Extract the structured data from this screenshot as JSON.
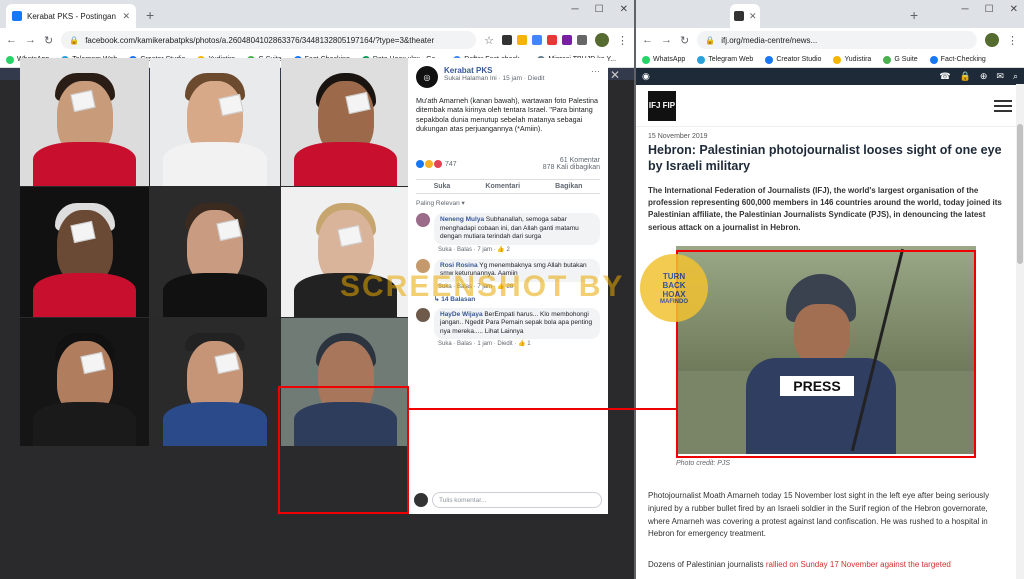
{
  "left_browser": {
    "tab_title": "Kerabat PKS - Postingan",
    "url": "facebook.com/kamikerabatpks/photos/a.2604804102863376/3448132805197164/?type=3&theater",
    "bookmarks": [
      "WhatsApp",
      "Telegram Web",
      "Creator Studio",
      "Yudistira",
      "G Suite",
      "Fact-Checking",
      "Data Hoax.xlsx - Go...",
      "Daftar Fact-check...",
      "Migrasi TBHJD ke Y..."
    ]
  },
  "post": {
    "page_name": "Kerabat PKS",
    "meta": "Sukai Halaman Ini · 15 jam · Diedit",
    "text": "Mu'ath Amarneh (kanan bawah), wartawan foto Palestina ditembak mata kirinya oleh tentara Israel. \"Para bintang sepakbola dunia menutup sebelah matanya sebagai dukungan atas perjuangannya (*Amiin).",
    "reactions_count": "747",
    "comments_count": "61 Komentar",
    "shares_count": "878 Kali dibagikan",
    "actions": [
      "Suka",
      "Komentari",
      "Bagikan"
    ],
    "sort_label": "Paling Relevan ▾",
    "comments": [
      {
        "name": "Neneng Mulya",
        "text": "Subhanallah, semoga sabar menghadapi cobaan ini, dan Allah ganti matamu dengan mutiara terindah dari surga",
        "meta": "Suka · Balas · 7 jam",
        "likes": "2"
      },
      {
        "name": "Rosi Rosina",
        "text": "Yg menembaknya smg Allah butakan smw keturunannya. Aamiin",
        "meta": "Suka · Balas · 7 jam",
        "likes": "28"
      },
      {
        "name": "HayDe Wijaya",
        "text": "BerEmpati harus... Klo membohongi jangan.. Ngedit Para Pemain sepak bola apa penting nya mereka..... Lihat Lainnya",
        "meta": "Suka · Balas · 1 jam · Diedit",
        "likes": "1"
      }
    ],
    "replies": "14 Balasan",
    "write_placeholder": "Tulis komentar..."
  },
  "watermark": "SCREENSHOT BY",
  "stamp_text": "TURN BACK HOAX · MASYARAKAT ANTI FITNAH INDONESIA · MAFINDO",
  "right_browser": {
    "url": "ifj.org/media-centre/news...",
    "bookmarks": [
      "WhatsApp",
      "Telegram Web",
      "Creator Studio",
      "Yudistira",
      "G Suite",
      "Fact-Checking"
    ]
  },
  "article": {
    "logo": "IFJ FIP",
    "date": "15 November 2019",
    "title": "Hebron: Palestinian photojournalist looses sight of one eye by Israeli military",
    "lead": "The International Federation of Journalists (IFJ), the world's largest organisation of the profession representing 600,000 members in 146 countries around the world, today joined its Palestinian affiliate, the Palestinian Journalists Syndicate (PJS), in denouncing the latest serious attack on a journalist in Hebron.",
    "photo_vest_text": "PRESS",
    "photo_credit": "Photo credit: PJS",
    "body": "Photojournalist Moath Amarneh today 15 November lost sight in the left eye after being seriously injured by a rubber bullet fired by an Israeli soldier in the Surif region of the Hebron governorate, where Amarneh was covering a protest against land confiscation. He was rushed to a hospital in Hebron for emergency treatment.",
    "body2_start": "Dozens of Palestinian journalists ",
    "body2_link": "rallied on Sunday 17 November against the targeted"
  },
  "colors": {
    "fb_blue": "#385898",
    "highlight_red": "#e00000",
    "ifj_navy": "#1e2a38",
    "watermark": "#e8a800"
  }
}
